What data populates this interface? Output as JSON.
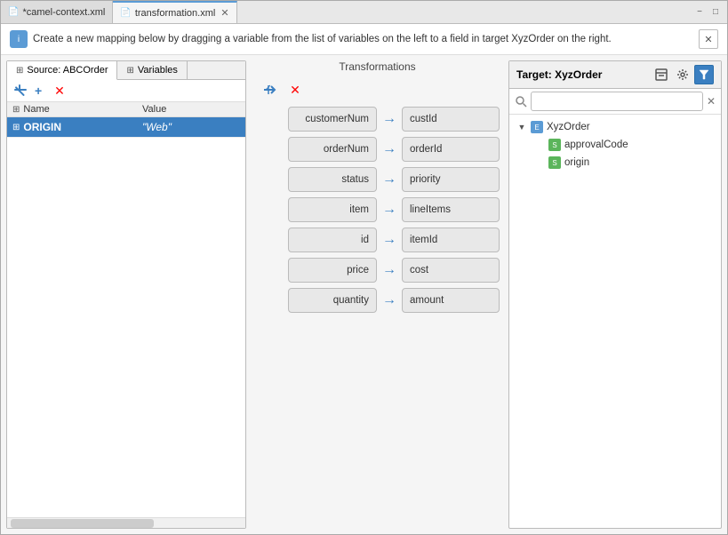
{
  "window": {
    "tab1_label": "*camel-context.xml",
    "tab2_label": "transformation.xml",
    "tab2_icon": "xml",
    "minimize_label": "−",
    "maximize_label": "□",
    "restore_label": "❐"
  },
  "toolbar": {
    "back_icon": "←",
    "forward_icon": "→"
  },
  "info_bar": {
    "text": "Create a new mapping below by dragging a variable from the list of variables on the left to a field in target XyzOrder on the right."
  },
  "left_panel": {
    "tab1_label": "Source: ABCOrder",
    "tab2_label": "Variables",
    "add_icon": "+",
    "delete_icon": "×",
    "col_name": "Name",
    "col_value": "Value",
    "variables": [
      {
        "name": "ORIGIN",
        "value": "\"Web\"",
        "selected": true
      }
    ]
  },
  "middle": {
    "title": "Transformations",
    "add_icon": "→",
    "delete_icon": "×",
    "mappings": [
      {
        "left": "customerNum",
        "right": "custId"
      },
      {
        "left": "orderNum",
        "right": "orderId"
      },
      {
        "left": "status",
        "right": "priority"
      },
      {
        "left": "item",
        "right": "lineItems"
      },
      {
        "left": "id",
        "right": "itemId"
      },
      {
        "left": "price",
        "right": "cost"
      },
      {
        "left": "quantity",
        "right": "amount"
      }
    ]
  },
  "right_panel": {
    "title": "Target: XyzOrder",
    "collapse_icon": "⊟",
    "settings_icon": "⚙",
    "filter_icon": "⚡",
    "search_placeholder": "",
    "tree": {
      "root_label": "XyzOrder",
      "children": [
        {
          "label": "approvalCode"
        },
        {
          "label": "origin"
        }
      ]
    }
  },
  "colors": {
    "accent_blue": "#3a7fc1",
    "selected_bg": "#3a7fc1",
    "tab_active_border": "#5b9bd5"
  }
}
